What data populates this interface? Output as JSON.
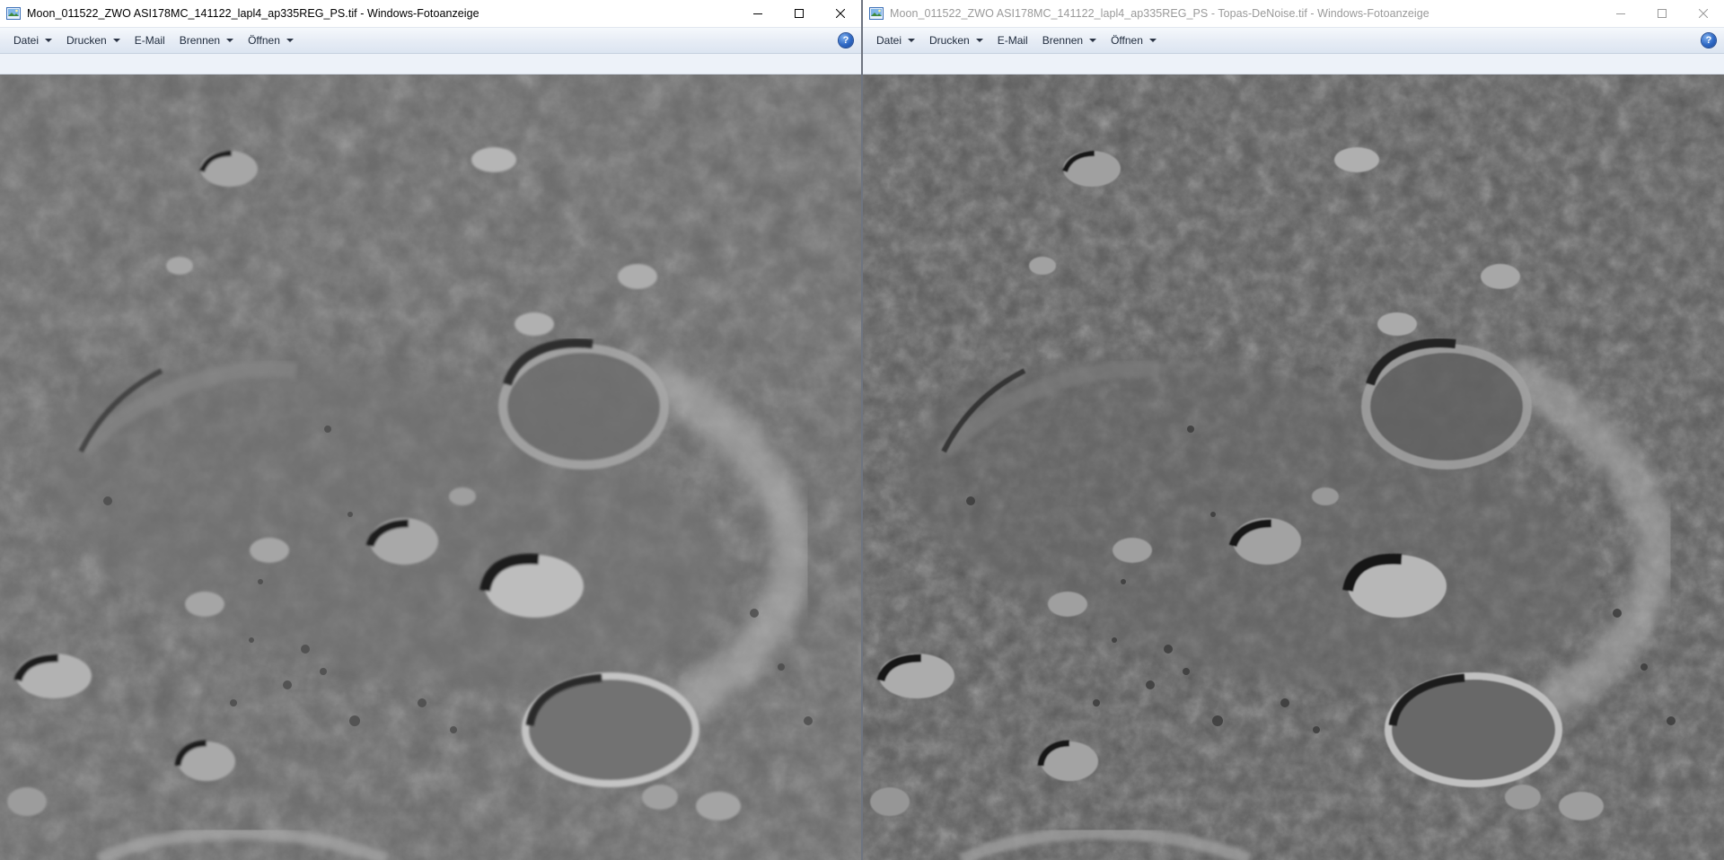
{
  "windows": [
    {
      "title": "Moon_011522_ZWO ASI178MC_141122_lapl4_ap335REG_PS.tif - Windows-Fotoanzeige",
      "active": true,
      "menu": [
        {
          "label": "Datei",
          "has_dropdown": true
        },
        {
          "label": "Drucken",
          "has_dropdown": true
        },
        {
          "label": "E-Mail",
          "has_dropdown": false
        },
        {
          "label": "Brennen",
          "has_dropdown": true
        },
        {
          "label": "Öffnen",
          "has_dropdown": true
        }
      ],
      "help": "?"
    },
    {
      "title": "Moon_011522_ZWO ASI178MC_141122_lapl4_ap335REG_PS - Topas-DeNoise.tif - Windows-Fotoanzeige",
      "active": false,
      "menu": [
        {
          "label": "Datei",
          "has_dropdown": true
        },
        {
          "label": "Drucken",
          "has_dropdown": true
        },
        {
          "label": "E-Mail",
          "has_dropdown": false
        },
        {
          "label": "Brennen",
          "has_dropdown": true
        },
        {
          "label": "Öffnen",
          "has_dropdown": true
        }
      ],
      "help": "?"
    }
  ],
  "icons": {
    "app": "photo-viewer-icon",
    "minimize": "minimize-icon",
    "maximize": "maximize-icon",
    "close": "close-icon",
    "help": "help-icon",
    "dropdown": "chevron-down-icon"
  },
  "colors": {
    "menubar_top": "#f5f8fc",
    "menubar_bottom": "#dce5f1",
    "menu_text": "#1e2a3c",
    "title_active": "#000000",
    "title_inactive": "#9a9a9a",
    "help_blue": "#2d67c4",
    "photo_base": "#6a6a6a"
  }
}
